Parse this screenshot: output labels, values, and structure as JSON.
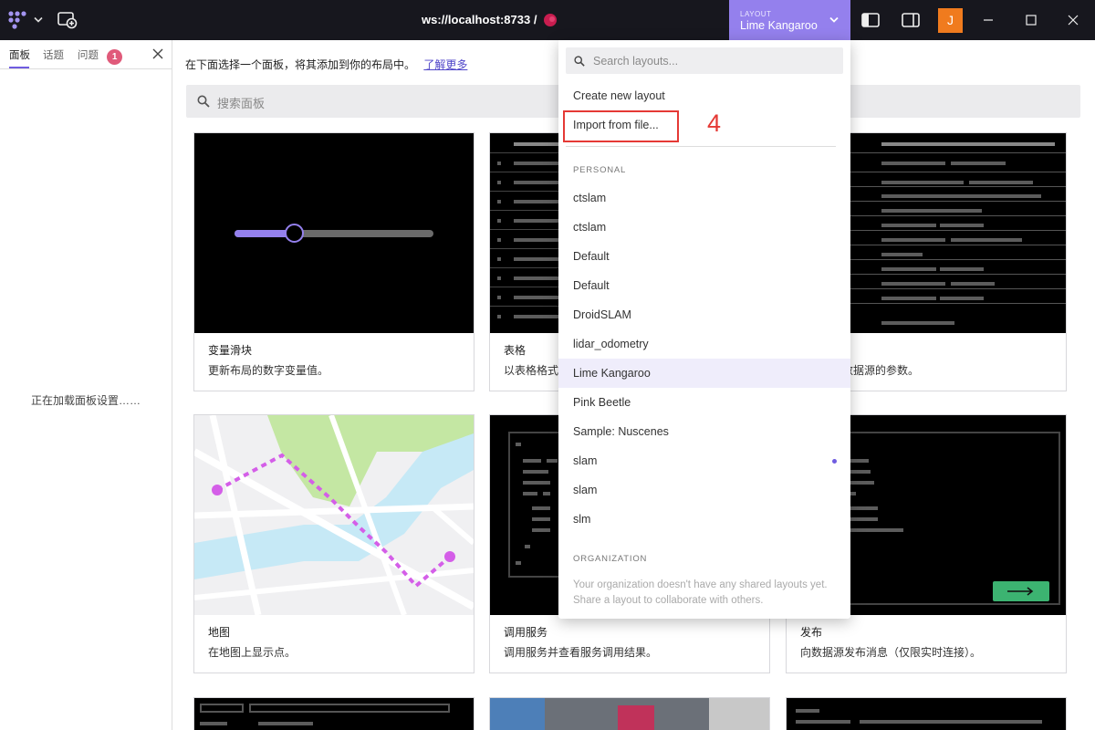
{
  "titlebar": {
    "connection": "ws://localhost:8733 /",
    "layout_label": "LAYOUT",
    "layout_name": "Lime Kangaroo",
    "user_initial": "J"
  },
  "sidebar": {
    "tabs": [
      "面板",
      "话题",
      "问题"
    ],
    "problems_badge": "1",
    "loading_text": "正在加载面板设置……"
  },
  "main": {
    "intro_text": "在下面选择一个面板，将其添加到你的布局中。",
    "learn_more": "了解更多",
    "search_placeholder": "搜索面板",
    "cards": [
      {
        "title": "变量滑块",
        "desc": "更新布局的数字变量值。"
      },
      {
        "title": "表格",
        "desc": "以表格格式"
      },
      {
        "title": "",
        "desc": "数据源的参数。"
      },
      {
        "title": "地图",
        "desc": "在地图上显示点。"
      },
      {
        "title": "调用服务",
        "desc": "调用服务并查看服务调用结果。"
      },
      {
        "title": "发布",
        "desc": "向数据源发布消息（仅限实时连接）。"
      }
    ]
  },
  "dropdown": {
    "search_placeholder": "Search layouts...",
    "create_new": "Create new layout",
    "import_file": "Import from file...",
    "annotation": "4",
    "personal_header": "PERSONAL",
    "personal_items": [
      "ctslam",
      "ctslam",
      "Default",
      "Default",
      "DroidSLAM",
      "lidar_odometry",
      "Lime Kangaroo",
      "Pink Beetle",
      "Sample: Nuscenes",
      "slam",
      "slam",
      "slm"
    ],
    "selected_item": "Lime Kangaroo",
    "organization_header": "ORGANIZATION",
    "organization_empty": "Your organization doesn't have any shared layouts yet. Share a layout to collaborate with others."
  },
  "colors": {
    "accent": "#9480ed",
    "badge": "#e05a7a",
    "annotation_red": "#e53935",
    "avatar_orange": "#f07b1e"
  }
}
